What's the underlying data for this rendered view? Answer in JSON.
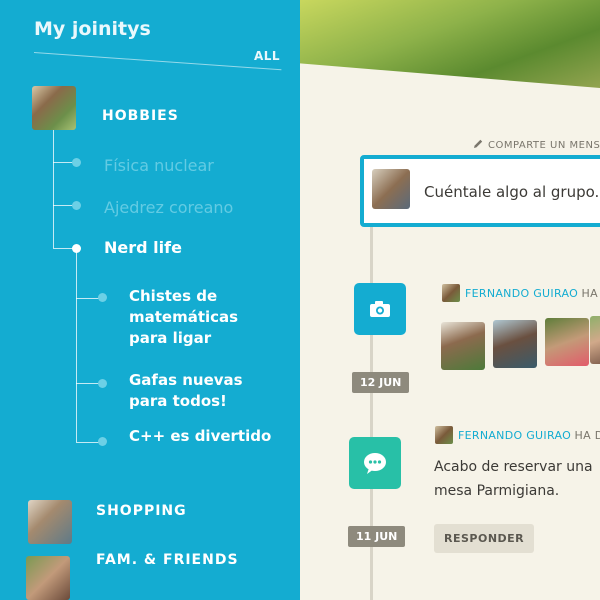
{
  "sidebar": {
    "title": "My joinitys",
    "all_label": "ALL",
    "categories": [
      {
        "label": "HOBBIES"
      },
      {
        "label": "SHOPPING"
      },
      {
        "label": "FAM. & FRIENDS"
      }
    ],
    "hobbies_items": [
      {
        "label": "Física nuclear"
      },
      {
        "label": "Ajedrez coreano"
      },
      {
        "label": "Nerd life"
      }
    ],
    "nerd_items": [
      {
        "label": "Chistes de matemáticas para ligar"
      },
      {
        "label": "Gafas nuevas para todos!"
      },
      {
        "label": "C++ es divertido"
      }
    ]
  },
  "main": {
    "compose_link": "COMPARTE UN MENSAJE",
    "compose_placeholder": "Cuéntale algo al grupo.",
    "posts": [
      {
        "author": "FERNANDO GUIRAO",
        "action": "HA SUB",
        "date": "12 JUN",
        "icon": "camera-icon"
      },
      {
        "author": "FERNANDO GUIRAO",
        "action": "HA DICHO",
        "date": "11 JUN",
        "icon": "chat-icon",
        "text": "Acabo de reservar una mesa Parmigiana.",
        "reply_label": "RESPONDER"
      }
    ]
  },
  "colors": {
    "accent": "#14acd1",
    "green": "#28c0a7",
    "background": "#f6f3e8"
  }
}
